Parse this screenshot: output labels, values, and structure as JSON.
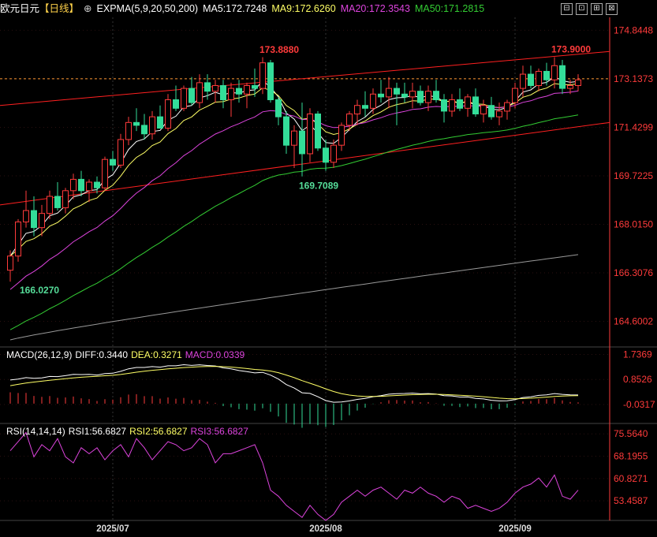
{
  "header": {
    "symbol": "欧元日元",
    "period": "【日线】",
    "plus_icon": "⊕",
    "expma_label": "EXPMA(5,9,20,50,200)",
    "ma5": "MA5:172.7248",
    "ma9": "MA9:172.6260",
    "ma20": "MA20:172.3543",
    "ma50": "MA50:171.2815"
  },
  "colors": {
    "up": "#ff3b3b",
    "down": "#33dd99",
    "ma5": "#ffffff",
    "ma9": "#ffff66",
    "ma20": "#dd44dd",
    "ma50": "#33cc33",
    "ma200": "#999999",
    "dif": "#ffffff",
    "dea": "#ffff66",
    "rsi": "#dd44dd",
    "axis": "#ff3b3b"
  },
  "toolbar": {
    "icons": [
      "minimize-icon",
      "restore-icon",
      "window-icon",
      "close-icon"
    ],
    "glyphs": [
      "⊟",
      "⊡",
      "⊞",
      "⊠"
    ]
  },
  "chart_data": {
    "type": "candlestick",
    "price_axis": {
      "ylim": [
        163.7,
        175.3
      ],
      "ticks": [
        "174.8448",
        "173.1373",
        "171.4299",
        "169.7225",
        "168.0150",
        "166.3076",
        "164.6002"
      ]
    },
    "current_price_dash": 173.1373,
    "annotations": [
      {
        "text": "173.8880",
        "value": 173.888,
        "index": 32
      },
      {
        "text": "173.9000",
        "value": 173.9,
        "index": 69
      },
      {
        "text": "169.7089",
        "value": 169.7089,
        "index": 37
      },
      {
        "text": "166.0270",
        "value": 166.027,
        "index": 1
      }
    ],
    "x_labels": [
      {
        "text": "2025/07",
        "index": 13
      },
      {
        "text": "2025/08",
        "index": 40
      },
      {
        "text": "2025/09",
        "index": 64
      }
    ],
    "candles": [
      [
        166.4,
        167.1,
        166.0,
        166.9
      ],
      [
        166.9,
        168.2,
        166.7,
        168.1
      ],
      [
        168.1,
        169.2,
        167.9,
        168.5
      ],
      [
        168.5,
        169.0,
        167.6,
        167.9
      ],
      [
        167.9,
        168.7,
        167.6,
        168.4
      ],
      [
        168.4,
        169.2,
        168.2,
        169.0
      ],
      [
        169.0,
        169.5,
        168.5,
        168.6
      ],
      [
        168.6,
        169.3,
        168.4,
        169.2
      ],
      [
        169.2,
        169.8,
        168.9,
        169.6
      ],
      [
        169.6,
        169.9,
        169.0,
        169.2
      ],
      [
        169.2,
        169.6,
        168.8,
        169.5
      ],
      [
        169.5,
        169.7,
        169.1,
        169.3
      ],
      [
        169.3,
        170.4,
        169.2,
        170.3
      ],
      [
        170.3,
        170.6,
        169.9,
        170.1
      ],
      [
        170.1,
        171.2,
        170.0,
        171.0
      ],
      [
        171.0,
        171.8,
        170.8,
        171.6
      ],
      [
        171.6,
        172.1,
        171.3,
        171.5
      ],
      [
        171.5,
        171.9,
        171.0,
        171.2
      ],
      [
        171.2,
        172.0,
        171.0,
        171.8
      ],
      [
        171.8,
        172.2,
        171.4,
        171.4
      ],
      [
        171.4,
        172.6,
        171.3,
        172.4
      ],
      [
        172.4,
        172.9,
        172.0,
        172.1
      ],
      [
        172.1,
        172.9,
        172.0,
        172.8
      ],
      [
        172.8,
        173.2,
        172.2,
        172.3
      ],
      [
        172.3,
        173.3,
        172.1,
        173.0
      ],
      [
        173.0,
        173.3,
        172.4,
        172.7
      ],
      [
        172.7,
        173.1,
        172.3,
        172.9
      ],
      [
        172.9,
        173.1,
        172.1,
        172.4
      ],
      [
        172.4,
        173.0,
        171.8,
        172.8
      ],
      [
        172.8,
        173.1,
        172.3,
        172.6
      ],
      [
        172.6,
        173.0,
        172.1,
        172.9
      ],
      [
        172.9,
        173.5,
        172.5,
        172.8
      ],
      [
        172.8,
        173.9,
        172.6,
        173.7
      ],
      [
        173.7,
        173.8,
        172.3,
        172.4
      ],
      [
        172.4,
        172.5,
        171.5,
        171.8
      ],
      [
        171.8,
        172.0,
        170.5,
        170.8
      ],
      [
        170.8,
        171.5,
        170.0,
        171.3
      ],
      [
        171.3,
        172.3,
        169.7,
        170.5
      ],
      [
        170.5,
        172.1,
        170.2,
        171.9
      ],
      [
        171.9,
        172.0,
        170.6,
        170.7
      ],
      [
        170.7,
        171.0,
        169.9,
        170.2
      ],
      [
        170.2,
        171.0,
        170.0,
        170.8
      ],
      [
        170.8,
        171.6,
        170.6,
        171.5
      ],
      [
        171.5,
        172.0,
        171.3,
        171.9
      ],
      [
        171.9,
        172.4,
        171.5,
        172.2
      ],
      [
        172.2,
        172.7,
        171.8,
        172.1
      ],
      [
        172.1,
        172.8,
        171.9,
        172.6
      ],
      [
        172.6,
        173.1,
        172.3,
        172.5
      ],
      [
        172.5,
        173.2,
        172.1,
        172.8
      ],
      [
        172.8,
        173.0,
        171.5,
        172.6
      ],
      [
        172.6,
        173.0,
        172.3,
        172.5
      ],
      [
        172.5,
        173.0,
        172.1,
        172.7
      ],
      [
        172.7,
        172.9,
        172.2,
        172.3
      ],
      [
        172.3,
        172.9,
        172.0,
        172.7
      ],
      [
        172.7,
        173.1,
        172.3,
        172.4
      ],
      [
        172.4,
        172.6,
        171.6,
        172.0
      ],
      [
        172.0,
        172.6,
        171.8,
        172.4
      ],
      [
        172.4,
        172.8,
        172.0,
        172.1
      ],
      [
        172.1,
        172.6,
        171.8,
        172.5
      ],
      [
        172.5,
        172.8,
        171.8,
        171.9
      ],
      [
        171.9,
        172.4,
        171.6,
        172.2
      ],
      [
        172.2,
        172.5,
        171.7,
        171.8
      ],
      [
        171.8,
        172.3,
        171.5,
        172.0
      ],
      [
        172.0,
        172.4,
        171.7,
        172.3
      ],
      [
        172.3,
        173.0,
        172.1,
        172.8
      ],
      [
        172.8,
        173.6,
        172.5,
        173.3
      ],
      [
        173.3,
        173.6,
        172.8,
        172.9
      ],
      [
        172.9,
        173.5,
        172.7,
        173.4
      ],
      [
        173.4,
        173.7,
        172.9,
        173.1
      ],
      [
        173.1,
        173.9,
        172.8,
        173.6
      ],
      [
        173.6,
        173.8,
        172.6,
        172.8
      ],
      [
        172.8,
        173.1,
        172.6,
        172.9
      ],
      [
        172.9,
        173.3,
        172.7,
        173.1
      ]
    ],
    "ma200_range": [
      163.95,
      166.95
    ],
    "channel": {
      "upper": [
        [
          0,
          172.2
        ],
        [
          72,
          174.1
        ]
      ],
      "lower": [
        [
          0,
          168.7
        ],
        [
          72,
          171.6
        ]
      ]
    },
    "macd": {
      "label": "MACD(26,12,9)",
      "diff": "DIFF:0.3440",
      "dea": "DEA:0.3271",
      "macd": "MACD:0.0339",
      "ylim": [
        -0.7,
        2.0
      ],
      "ticks": [
        "1.7369",
        "0.8526",
        "-0.0317"
      ]
    },
    "rsi": {
      "label": "RSI(14,14,14)",
      "rsi1": "RSI1:56.6827",
      "rsi2": "RSI2:56.6827",
      "rsi3": "RSI3:56.6827",
      "ylim": [
        47,
        79
      ],
      "ticks": [
        "75.5640",
        "68.1955",
        "60.8271",
        "53.4587"
      ],
      "values": [
        70,
        73,
        76,
        68,
        72,
        70,
        74,
        68,
        66,
        71,
        69,
        71,
        67,
        70,
        72,
        68,
        74,
        71,
        67,
        70,
        73,
        72,
        70,
        71,
        74,
        72,
        66,
        69,
        69,
        70,
        71,
        72,
        66,
        57,
        55,
        52,
        50,
        48,
        52,
        49,
        47,
        49,
        53,
        55,
        57,
        55,
        57,
        58,
        56,
        54,
        57,
        56,
        58,
        56,
        55,
        53,
        55,
        54,
        51,
        52,
        51,
        50,
        51,
        53,
        56,
        58,
        59,
        61,
        58,
        62,
        55,
        54,
        57
      ]
    }
  }
}
